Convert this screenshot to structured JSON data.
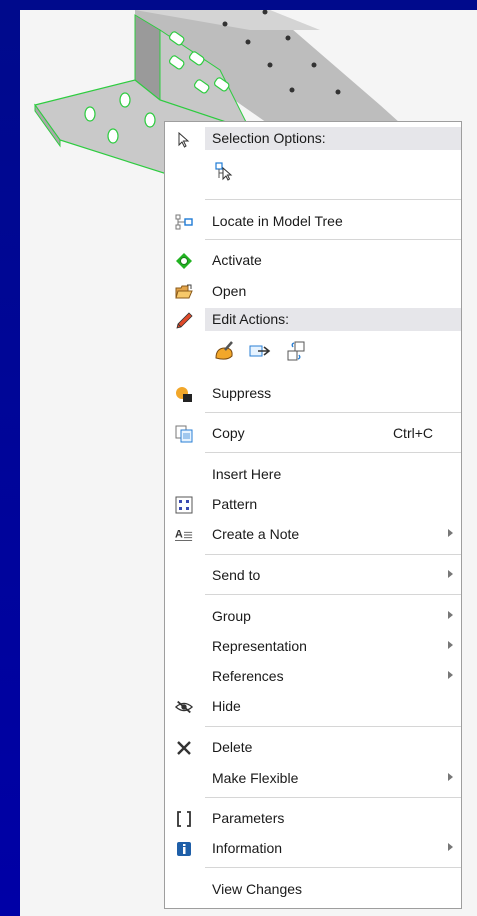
{
  "menu": {
    "selection_options_label": "Selection Options:",
    "locate_label": "Locate in Model Tree",
    "activate_label": "Activate",
    "open_label": "Open",
    "edit_actions_label": "Edit Actions:",
    "suppress_label": "Suppress",
    "copy_label": "Copy",
    "copy_shortcut": "Ctrl+C",
    "insert_here_label": "Insert Here",
    "pattern_label": "Pattern",
    "create_note_label": "Create a Note",
    "send_to_label": "Send to",
    "group_label": "Group",
    "representation_label": "Representation",
    "references_label": "References",
    "hide_label": "Hide",
    "delete_label": "Delete",
    "make_flexible_label": "Make Flexible",
    "parameters_label": "Parameters",
    "information_label": "Information",
    "view_changes_label": "View Changes"
  },
  "colors": {
    "background": "#000a8c",
    "model_gray": "#b9b9b9",
    "model_edge": "#2ecc40"
  }
}
